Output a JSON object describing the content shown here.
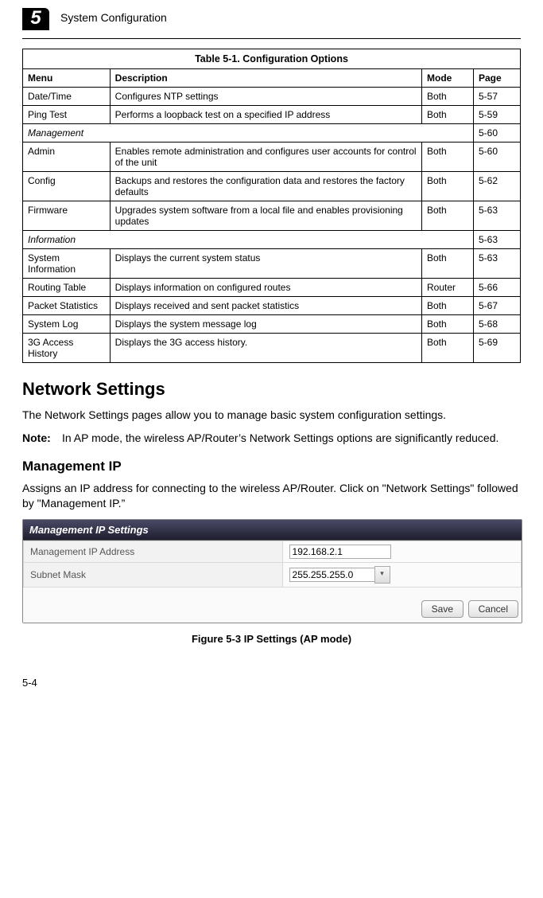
{
  "header": {
    "chapterNumber": "5",
    "chapterTitle": "System Configuration"
  },
  "table": {
    "caption": "Table 5-1. Configuration Options",
    "headers": {
      "menu": "Menu",
      "description": "Description",
      "mode": "Mode",
      "page": "Page"
    },
    "rows": [
      {
        "type": "item",
        "menu": "Date/Time",
        "desc": "Configures NTP settings",
        "mode": "Both",
        "page": "5-57"
      },
      {
        "type": "item",
        "menu": "Ping Test",
        "desc": "Performs a loopback test on a specified IP address",
        "mode": "Both",
        "page": "5-59"
      },
      {
        "type": "section",
        "menu": "Management",
        "page": "5-60"
      },
      {
        "type": "item",
        "menu": "Admin",
        "desc": "Enables remote administration and configures user accounts for control of the unit",
        "mode": "Both",
        "page": "5-60"
      },
      {
        "type": "item",
        "menu": "Config",
        "desc": "Backups and restores the configuration data and restores the factory defaults",
        "mode": "Both",
        "page": "5-62"
      },
      {
        "type": "item",
        "menu": "Firmware",
        "desc": "Upgrades system software from a local file and enables provisioning updates",
        "mode": "Both",
        "page": "5-63"
      },
      {
        "type": "section",
        "menu": "Information",
        "page": "5-63"
      },
      {
        "type": "item",
        "menu": "System Information",
        "desc": "Displays the current system status",
        "mode": "Both",
        "page": "5-63"
      },
      {
        "type": "item",
        "menu": "Routing Table",
        "desc": "Displays information on configured routes",
        "mode": "Router",
        "page": "5-66"
      },
      {
        "type": "item",
        "menu": "Packet Statistics",
        "desc": "Displays received and sent packet statistics",
        "mode": "Both",
        "page": "5-67"
      },
      {
        "type": "item",
        "menu": "System Log",
        "desc": "Displays the system message log",
        "mode": "Both",
        "page": "5-68"
      },
      {
        "type": "item",
        "menu": "3G Access History",
        "desc": "Displays the 3G access history.",
        "mode": "Both",
        "page": "5-69"
      }
    ]
  },
  "body": {
    "h1": "Network Settings",
    "p1": "The Network Settings pages allow you to manage basic system configuration settings.",
    "noteLabel": "Note:",
    "noteBody": "In AP mode, the wireless AP/Router’s Network Settings options are significantly reduced.",
    "h2": "Management IP",
    "p2": "Assigns an IP address for connecting to the wireless AP/Router. Click on \"Network Settings\" followed by \"Management IP.”"
  },
  "ipPanel": {
    "title": "Management IP Settings",
    "rows": {
      "ipLabel": "Management IP Address",
      "ipValue": "192.168.2.1",
      "maskLabel": "Subnet Mask",
      "maskValue": "255.255.255.0"
    },
    "buttons": {
      "save": "Save",
      "cancel": "Cancel"
    }
  },
  "figureCaption": "Figure 5-3  IP Settings (AP mode)",
  "pageNumber": "5-4"
}
